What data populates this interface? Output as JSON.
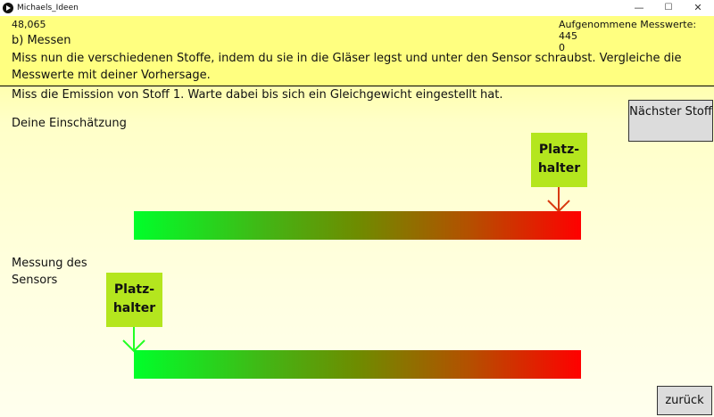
{
  "window": {
    "title": "Michaels_Ideen",
    "icon": "processing-play-icon"
  },
  "header": {
    "value_readout": "48,065",
    "recorded_label": "Aufgenommene Messwerte: 445",
    "recorded_value": "0",
    "section_title": "b) Messen",
    "instructions": "Miss nun die verschiedenen Stoffe, indem du sie in die Gläser legst und unter den Sensor schraubst. Vergleiche die Messwerte mit deiner Vorhersage."
  },
  "task": "Miss die Emission von Stoff 1. Warte dabei bis sich ein Gleichgewicht eingestellt hat.",
  "estimate": {
    "label": "Deine Einschätzung",
    "marker_text": "Platz-\nhalter",
    "level": 0.95,
    "arrow_color": "#d83a0f"
  },
  "sensor": {
    "label": "Messung des Sensors",
    "marker_text": "Platz-\nhalter",
    "level": 0.0,
    "arrow_color": "#22ff22"
  },
  "buttons": {
    "next": "Nächster Stoff",
    "back": "zurück"
  },
  "colors": {
    "header_background": "#ffff80",
    "marker_background": "#b4e61e",
    "scale_low": "#00ff2a",
    "scale_high": "#ff0000"
  }
}
